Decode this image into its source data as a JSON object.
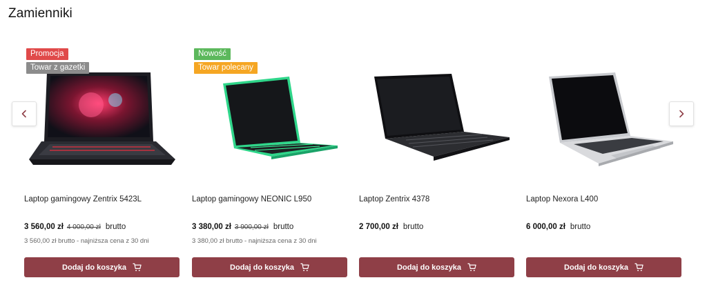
{
  "section": {
    "title": "Zamienniki"
  },
  "colors": {
    "accent": "#8f3f47",
    "promo": "#e04a4a",
    "gazette": "#8c8c8c",
    "new": "#5cb85c",
    "recommended": "#f5a623"
  },
  "nav": {
    "prev_icon": "chevron-left-icon",
    "next_icon": "chevron-right-icon"
  },
  "products": [
    {
      "name": "Laptop gamingowy Zentrix 5423L",
      "badges": [
        "Promocja",
        "Towar z gazetki"
      ],
      "price": "3 560,00 zł",
      "old_price": "4 000,00 zł",
      "gross": "brutto",
      "lowest": "3 560,00 zł brutto - najniższa cena z 30 dni",
      "button": "Dodaj do koszyka"
    },
    {
      "name": "Laptop gamingowy NEONIC L950",
      "badges": [
        "Nowość",
        "Towar polecany"
      ],
      "price": "3 380,00 zł",
      "old_price": "3 900,00 zł",
      "gross": "brutto",
      "lowest": "3 380,00 zł brutto - najniższa cena z 30 dni",
      "button": "Dodaj do koszyka"
    },
    {
      "name": "Laptop Zentrix 4378",
      "price": "2 700,00 zł",
      "gross": "brutto",
      "button": "Dodaj do koszyka"
    },
    {
      "name": "Laptop Nexora L400",
      "price": "6 000,00 zł",
      "gross": "brutto",
      "button": "Dodaj do koszyka"
    }
  ]
}
